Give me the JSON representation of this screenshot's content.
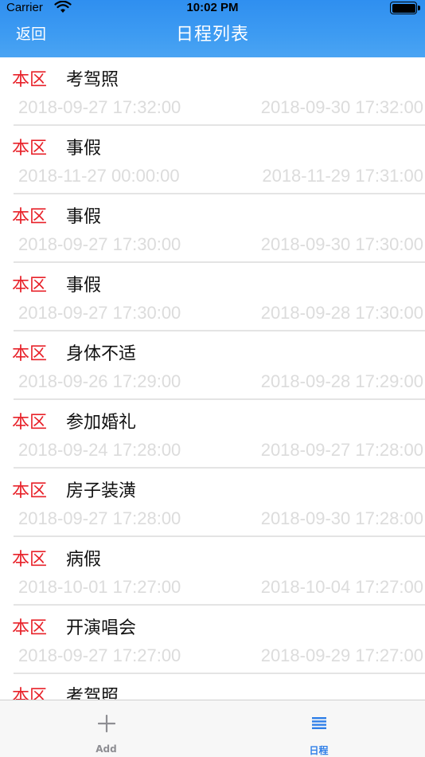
{
  "status_bar": {
    "carrier": "Carrier",
    "time": "10:02 PM"
  },
  "nav": {
    "back_label": "返回",
    "title": "日程列表"
  },
  "items": [
    {
      "region": "本区",
      "title": "考驾照",
      "start": "2018-09-27 17:32:00",
      "end": "2018-09-30 17:32:00"
    },
    {
      "region": "本区",
      "title": "事假",
      "start": "2018-11-27 00:00:00",
      "end": "2018-11-29 17:31:00"
    },
    {
      "region": "本区",
      "title": "事假",
      "start": "2018-09-27 17:30:00",
      "end": "2018-09-30 17:30:00"
    },
    {
      "region": "本区",
      "title": "事假",
      "start": "2018-09-27 17:30:00",
      "end": "2018-09-28 17:30:00"
    },
    {
      "region": "本区",
      "title": "身体不适",
      "start": "2018-09-26 17:29:00",
      "end": "2018-09-28 17:29:00"
    },
    {
      "region": "本区",
      "title": "参加婚礼",
      "start": "2018-09-24 17:28:00",
      "end": "2018-09-27 17:28:00"
    },
    {
      "region": "本区",
      "title": "房子装潢",
      "start": "2018-09-27 17:28:00",
      "end": "2018-09-30 17:28:00"
    },
    {
      "region": "本区",
      "title": "病假",
      "start": "2018-10-01 17:27:00",
      "end": "2018-10-04 17:27:00"
    },
    {
      "region": "本区",
      "title": "开演唱会",
      "start": "2018-09-27 17:27:00",
      "end": "2018-09-29 17:27:00"
    },
    {
      "region": "本区",
      "title": "考驾照",
      "start": "",
      "end": ""
    }
  ],
  "tabbar": {
    "add_label": "Add",
    "schedule_label": "日程",
    "add_icon": "plus-icon",
    "schedule_icon": "list-icon"
  },
  "colors": {
    "nav_background": "#3d9bf2",
    "region_text": "#e8222a",
    "date_text": "#dcdcdc",
    "active_tab": "#2f7fe8",
    "inactive_tab": "#8e8e93"
  }
}
